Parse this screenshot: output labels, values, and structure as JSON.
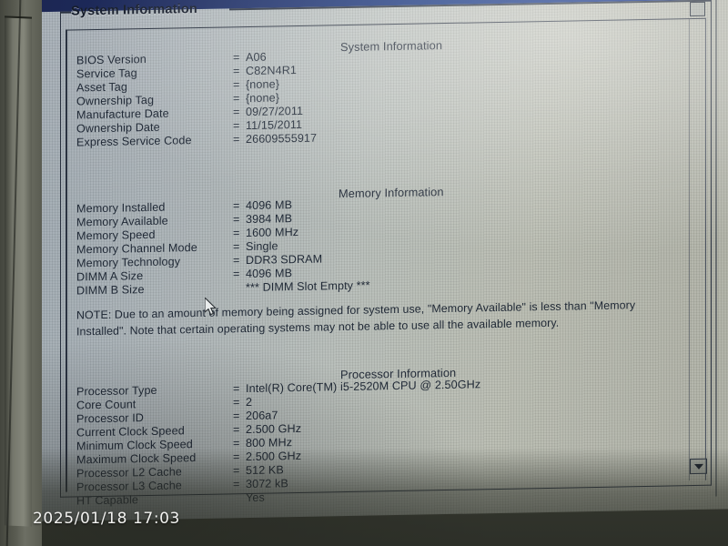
{
  "screen": {
    "legend": "System Information",
    "sections": [
      {
        "title": "System Information",
        "rows": [
          {
            "label": "BIOS Version",
            "eq": "=",
            "value": "A06"
          },
          {
            "label": "Service Tag",
            "eq": "=",
            "value": "C82N4R1"
          },
          {
            "label": "Asset Tag",
            "eq": "=",
            "value": "{none}"
          },
          {
            "label": "Ownership Tag",
            "eq": "=",
            "value": "{none}"
          },
          {
            "label": "Manufacture Date",
            "eq": "=",
            "value": "09/27/2011"
          },
          {
            "label": "Ownership Date",
            "eq": "=",
            "value": "11/15/2011"
          },
          {
            "label": "Express Service Code",
            "eq": "=",
            "value": "26609555917"
          }
        ]
      },
      {
        "title": "Memory Information",
        "rows": [
          {
            "label": "Memory Installed",
            "eq": "=",
            "value": "4096 MB"
          },
          {
            "label": "Memory Available",
            "eq": "=",
            "value": "3984 MB"
          },
          {
            "label": "Memory Speed",
            "eq": "=",
            "value": "1600 MHz"
          },
          {
            "label": "Memory Channel Mode",
            "eq": "=",
            "value": "Single"
          },
          {
            "label": "Memory Technology",
            "eq": "=",
            "value": "DDR3 SDRAM"
          },
          {
            "label": "DIMM A Size",
            "eq": "=",
            "value": "4096 MB"
          },
          {
            "label": "DIMM B Size",
            "eq": "",
            "value": "*** DIMM Slot Empty ***"
          }
        ]
      },
      {
        "title": "Processor Information",
        "rows": [
          {
            "label": "Processor Type",
            "eq": "=",
            "value": "Intel(R) Core(TM) i5-2520M CPU @ 2.50GHz"
          },
          {
            "label": "Core Count",
            "eq": "=",
            "value": "2"
          },
          {
            "label": "Processor ID",
            "eq": "=",
            "value": "206a7"
          },
          {
            "label": "Current Clock Speed",
            "eq": "=",
            "value": "2.500 GHz"
          },
          {
            "label": "Minimum Clock Speed",
            "eq": "=",
            "value": "800 MHz"
          },
          {
            "label": "Maximum Clock Speed",
            "eq": "=",
            "value": "2.500 GHz"
          },
          {
            "label": "Processor L2 Cache",
            "eq": "=",
            "value": "512 KB"
          },
          {
            "label": "Processor L3 Cache",
            "eq": "=",
            "value": "3072 kB"
          },
          {
            "label": "HT Capable",
            "eq": "",
            "value": "Yes"
          }
        ]
      }
    ],
    "note": "NOTE: Due to an amount of memory being assigned for system use, \"Memory Available\" is less than \"Memory Installed\". Note that certain operating systems may not be able to use all the available memory."
  },
  "photo": {
    "timestamp": "2025/01/18 17:03"
  },
  "colors": {
    "header_band": "#0a2a86",
    "screen_base": "#b7bdb9",
    "text": "#1f2835",
    "border": "#2a3240",
    "timestamp_text": "#f2f2f0"
  }
}
